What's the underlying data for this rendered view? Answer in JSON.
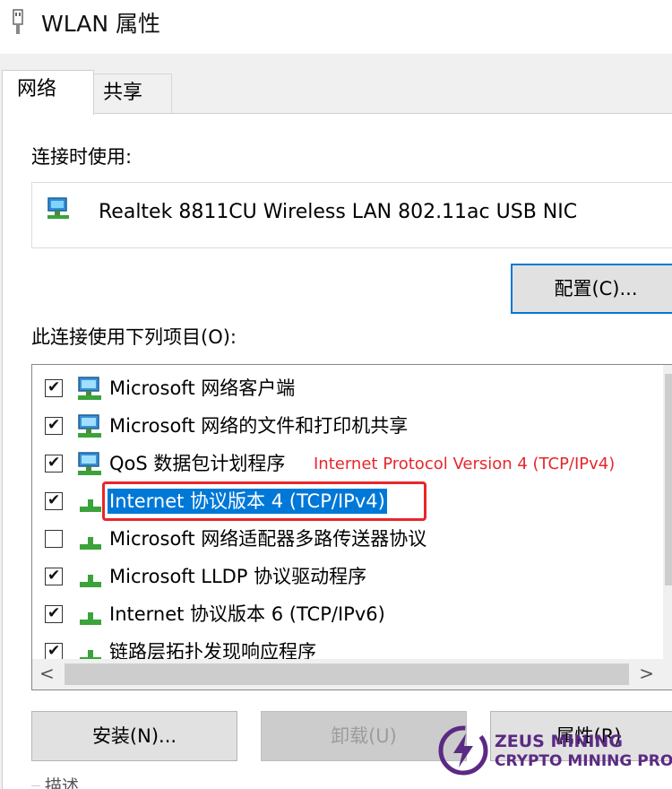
{
  "window": {
    "title": "WLAN 属性",
    "icon": "network-adapter-icon"
  },
  "tabs": [
    {
      "label": "网络",
      "active": true
    },
    {
      "label": "共享",
      "active": false
    }
  ],
  "connection": {
    "label": "连接时使用:",
    "adapter_name": "Realtek 8811CU Wireless LAN 802.11ac USB NIC",
    "configure_button": "配置(C)..."
  },
  "items_section": {
    "label": "此连接使用下列项目(O):",
    "items": [
      {
        "label": "Microsoft 网络客户端",
        "checked": true,
        "icon": "network-client-icon"
      },
      {
        "label": "Microsoft 网络的文件和打印机共享",
        "checked": true,
        "icon": "network-client-icon"
      },
      {
        "label": "QoS 数据包计划程序",
        "checked": true,
        "icon": "network-client-icon"
      },
      {
        "label": "Internet 协议版本 4 (TCP/IPv4)",
        "checked": true,
        "icon": "protocol-icon",
        "selected": true
      },
      {
        "label": "Microsoft 网络适配器多路传送器协议",
        "checked": false,
        "icon": "protocol-icon"
      },
      {
        "label": "Microsoft LLDP 协议驱动程序",
        "checked": true,
        "icon": "protocol-icon"
      },
      {
        "label": "Internet 协议版本 6 (TCP/IPv6)",
        "checked": true,
        "icon": "protocol-icon"
      },
      {
        "label": "链路层拓扑发现响应程序",
        "checked": true,
        "icon": "protocol-icon"
      }
    ]
  },
  "annotation": "Internet Protocol Version 4 (TCP/IPv4)",
  "buttons": {
    "install": "安装(N)...",
    "uninstall": "卸载(U)",
    "properties": "属性(R)"
  },
  "description_label": "描述",
  "watermark": {
    "line1": "ZEUS MINING",
    "line2": "CRYPTO MINING PRO",
    "color": "#5b2a84"
  },
  "colors": {
    "selection": "#0078d7",
    "annotation": "#e8262b"
  }
}
